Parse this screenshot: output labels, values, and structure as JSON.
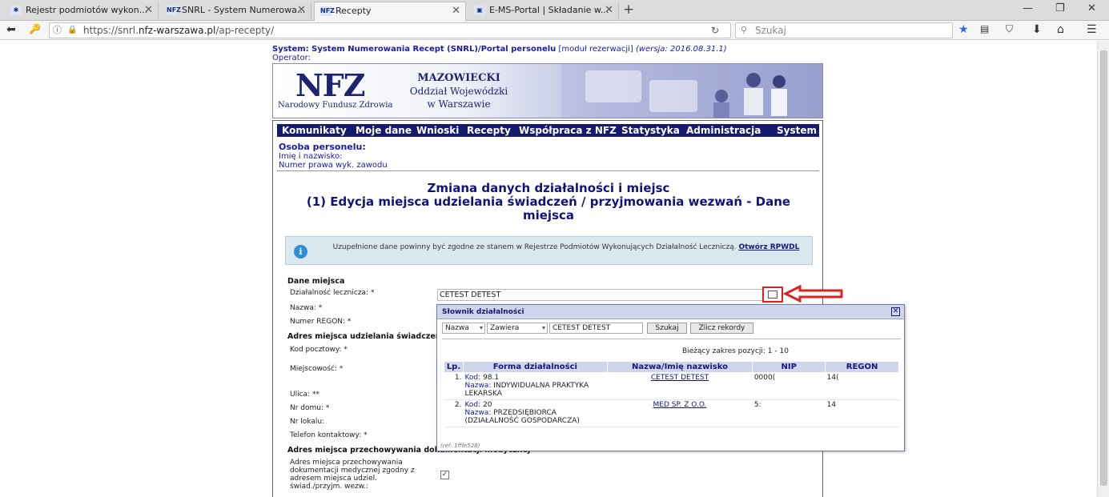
{
  "browser": {
    "tabs": [
      {
        "label": "Rejestr podmiotów wykon...",
        "favicon": "✱"
      },
      {
        "label": "SNRL - System Numerowa...",
        "favicon": "NFZ"
      },
      {
        "label": "Recepty",
        "favicon": "NFZ"
      },
      {
        "label": "E-MS-Portal | Składanie w...",
        "favicon": "▣"
      }
    ],
    "url_prefix": "https://snrl.",
    "url_domain": "nfz-warszawa.pl",
    "url_path": "/ap-recepty/",
    "search_placeholder": "Szukaj"
  },
  "header": {
    "system_label": "System: System Numerowania Recept (SNRL)/Portal personelu",
    "module": "[moduł rezerwacji]",
    "version": "(wersja: 2016.08.31.1)",
    "operator": "Operator:"
  },
  "banner": {
    "logo": "NFZ",
    "logo_sub": "Narodowy Fundusz Zdrowia",
    "line1": "MAZOWIECKI",
    "line2": "Oddział Wojewódzki",
    "line3": "w Warszawie"
  },
  "menu": [
    "Komunikaty",
    "Moje dane",
    "Wnioski",
    "Recepty",
    "Współpraca z NFZ",
    "Statystyka",
    "Administracja",
    "System"
  ],
  "person": {
    "heading": "Osoba personelu:",
    "name_label": "Imię i nazwisko:",
    "license_label": "Numer prawa wyk. zawodu"
  },
  "page": {
    "title1": "Zmiana danych działalności i miejsc",
    "title2": "(1) Edycja miejsca udzielania świadczeń / przyjmowania wezwań - Dane miejsca"
  },
  "info": {
    "text": "Uzupełnione dane powinny być zgodne ze stanem w Rejestrze Podmiotów Wykonujących Działalność Leczniczą.",
    "link": "Otwórz RPWDL"
  },
  "form": {
    "section1": "Dane miejsca",
    "activity_label": "Działalność lecznicza: *",
    "activity_value": "CETEST DETEST",
    "name_label": "Nazwa: *",
    "regon_label": "Numer REGON: *",
    "section2": "Adres miejsca udzielania świadczeń",
    "postal_label": "Kod pocztowy: *",
    "city_label": "Miejscowość: *",
    "street_label": "Ulica: **",
    "house_label": "Nr domu: *",
    "flat_label": "Nr lokalu:",
    "phone_label": "Telefon kontaktowy: *",
    "section3": "Adres miejsca przechowywania dokumentacji medycznej",
    "same_address_label_1": "Adres miejsca przechowywania",
    "same_address_label_2": "dokumentacji medycznej zgodny z",
    "same_address_label_3": "adresem miejsca udziel.",
    "same_address_label_4": "świad./przyjm. wezw.:",
    "same_address_checked": "✓"
  },
  "dialog": {
    "title": "Słownik działalności",
    "field_select": "Nazwa",
    "op_select": "Zawiera",
    "query": "CETEST DETEST",
    "search_btn": "Szukaj",
    "count_btn": "Zlicz rekordy",
    "range": "Bieżący zakres pozycji: 1 - 10",
    "columns": [
      "Lp.",
      "Forma działalności",
      "Nazwa/Imię nazwisko",
      "NIP",
      "REGON"
    ],
    "kod_label": "Kod:",
    "nazwa_label": "Nazwa:",
    "rows": [
      {
        "lp": "1.",
        "kod": "98.1",
        "nazwa": "INDYWIDUALNA PRAKTYKA LEKARSKA",
        "name": "CETEST DETEST",
        "nip": "0000(",
        "regon": "14("
      },
      {
        "lp": "2.",
        "kod": "20",
        "nazwa": "PRZEDSIĘBIORCA (DZIAŁALNOŚĆ GOSPODARCZA)",
        "name": "MED SP. Z O.O.",
        "nip": "5:",
        "regon": "14"
      }
    ],
    "ref": "(ref: 1fffe528)"
  }
}
